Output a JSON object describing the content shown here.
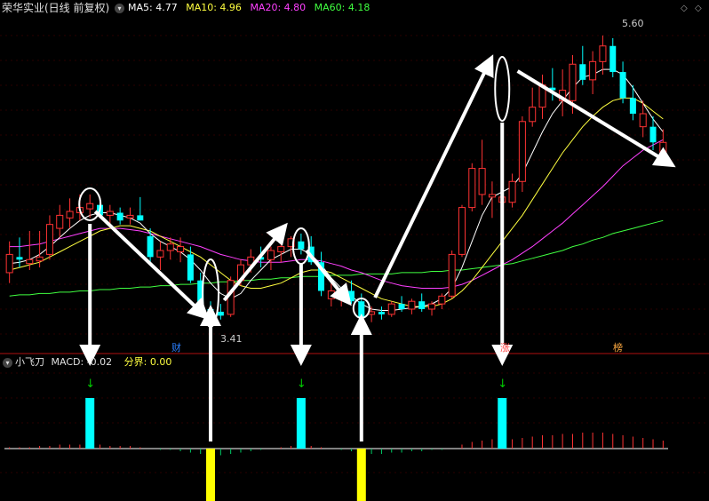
{
  "main_panel": {
    "stock_title": "荣华实业(日线 前复权)",
    "ma_labels": [
      {
        "text": "MA5: 4.77",
        "color": "#ffffff"
      },
      {
        "text": "MA10: 4.96",
        "color": "#ffff40"
      },
      {
        "text": "MA20: 4.80",
        "color": "#ff40ff"
      },
      {
        "text": "MA60: 4.18",
        "color": "#40ff40"
      }
    ],
    "high_marker": "5.60",
    "low_marker": "3.41",
    "badges": [
      {
        "text": "财",
        "color": "#2a7fff"
      },
      {
        "text": "涨",
        "color": "#ff4040"
      },
      {
        "text": "榜",
        "color": "#ffaa40"
      }
    ]
  },
  "sub_panel": {
    "indicator_name": "小飞刀",
    "macd_label": "MACD: -0.02",
    "boundary_label": "分界: 0.00"
  },
  "colors": {
    "up": "#ff3333",
    "down": "#00ffff",
    "ma5": "#ffffff",
    "ma10": "#ffff40",
    "ma20": "#ff40ff",
    "ma60": "#40ff40",
    "signal_bar": "#00ffff",
    "low_signal_bar": "#ffff00",
    "signal_arrow": "#00cc00",
    "divider": "#b01010"
  },
  "chart_data": {
    "type": "candlestick",
    "main_y_range": [
      3.2,
      5.75
    ],
    "candles": [
      {
        "o": 3.78,
        "h": 4.02,
        "l": 3.7,
        "c": 3.92,
        "up": true
      },
      {
        "o": 3.9,
        "h": 4.05,
        "l": 3.82,
        "c": 3.88,
        "up": false
      },
      {
        "o": 3.85,
        "h": 4.1,
        "l": 3.8,
        "c": 3.88,
        "up": true
      },
      {
        "o": 3.87,
        "h": 4.1,
        "l": 3.82,
        "c": 3.9,
        "up": true
      },
      {
        "o": 3.92,
        "h": 4.22,
        "l": 3.88,
        "c": 4.15,
        "up": true
      },
      {
        "o": 4.12,
        "h": 4.3,
        "l": 4.05,
        "c": 4.22,
        "up": true
      },
      {
        "o": 4.2,
        "h": 4.35,
        "l": 4.12,
        "c": 4.25,
        "up": true
      },
      {
        "o": 4.24,
        "h": 4.38,
        "l": 4.18,
        "c": 4.28,
        "up": true
      },
      {
        "o": 4.27,
        "h": 4.38,
        "l": 4.2,
        "c": 4.31,
        "up": true
      },
      {
        "o": 4.3,
        "h": 4.35,
        "l": 4.2,
        "c": 4.22,
        "up": false
      },
      {
        "o": 4.22,
        "h": 4.3,
        "l": 4.12,
        "c": 4.25,
        "up": true
      },
      {
        "o": 4.24,
        "h": 4.28,
        "l": 4.15,
        "c": 4.18,
        "up": false
      },
      {
        "o": 4.2,
        "h": 4.28,
        "l": 4.15,
        "c": 4.22,
        "up": true
      },
      {
        "o": 4.22,
        "h": 4.36,
        "l": 4.18,
        "c": 4.18,
        "up": false
      },
      {
        "o": 4.06,
        "h": 4.12,
        "l": 3.85,
        "c": 3.9,
        "up": false
      },
      {
        "o": 3.9,
        "h": 4.02,
        "l": 3.8,
        "c": 3.95,
        "up": true
      },
      {
        "o": 3.95,
        "h": 4.05,
        "l": 3.88,
        "c": 4.0,
        "up": true
      },
      {
        "o": 3.98,
        "h": 4.05,
        "l": 3.86,
        "c": 3.94,
        "up": true
      },
      {
        "o": 3.92,
        "h": 3.98,
        "l": 3.7,
        "c": 3.72,
        "up": false
      },
      {
        "o": 3.72,
        "h": 3.78,
        "l": 3.45,
        "c": 3.5,
        "up": false
      },
      {
        "o": 3.5,
        "h": 3.56,
        "l": 3.41,
        "c": 3.48,
        "up": false
      },
      {
        "o": 3.48,
        "h": 3.54,
        "l": 3.42,
        "c": 3.45,
        "up": false
      },
      {
        "o": 3.46,
        "h": 3.75,
        "l": 3.44,
        "c": 3.72,
        "up": true
      },
      {
        "o": 3.72,
        "h": 3.88,
        "l": 3.68,
        "c": 3.84,
        "up": true
      },
      {
        "o": 3.84,
        "h": 3.96,
        "l": 3.78,
        "c": 3.9,
        "up": true
      },
      {
        "o": 3.9,
        "h": 3.98,
        "l": 3.82,
        "c": 3.88,
        "up": false
      },
      {
        "o": 3.88,
        "h": 3.98,
        "l": 3.8,
        "c": 3.95,
        "up": true
      },
      {
        "o": 3.94,
        "h": 4.0,
        "l": 3.86,
        "c": 3.98,
        "up": true
      },
      {
        "o": 3.98,
        "h": 4.06,
        "l": 3.9,
        "c": 4.04,
        "up": true
      },
      {
        "o": 4.02,
        "h": 4.08,
        "l": 3.92,
        "c": 3.96,
        "up": false
      },
      {
        "o": 3.98,
        "h": 4.06,
        "l": 3.84,
        "c": 3.86,
        "up": false
      },
      {
        "o": 3.86,
        "h": 3.94,
        "l": 3.6,
        "c": 3.64,
        "up": false
      },
      {
        "o": 3.64,
        "h": 3.7,
        "l": 3.52,
        "c": 3.58,
        "up": true
      },
      {
        "o": 3.58,
        "h": 3.66,
        "l": 3.52,
        "c": 3.62,
        "up": true
      },
      {
        "o": 3.64,
        "h": 3.72,
        "l": 3.54,
        "c": 3.56,
        "up": false
      },
      {
        "o": 3.56,
        "h": 3.62,
        "l": 3.42,
        "c": 3.44,
        "up": false
      },
      {
        "o": 3.46,
        "h": 3.52,
        "l": 3.4,
        "c": 3.48,
        "up": true
      },
      {
        "o": 3.48,
        "h": 3.52,
        "l": 3.42,
        "c": 3.46,
        "up": false
      },
      {
        "o": 3.46,
        "h": 3.56,
        "l": 3.44,
        "c": 3.54,
        "up": true
      },
      {
        "o": 3.54,
        "h": 3.6,
        "l": 3.48,
        "c": 3.5,
        "up": false
      },
      {
        "o": 3.5,
        "h": 3.58,
        "l": 3.46,
        "c": 3.56,
        "up": true
      },
      {
        "o": 3.56,
        "h": 3.62,
        "l": 3.48,
        "c": 3.5,
        "up": false
      },
      {
        "o": 3.5,
        "h": 3.56,
        "l": 3.45,
        "c": 3.54,
        "up": true
      },
      {
        "o": 3.54,
        "h": 3.62,
        "l": 3.5,
        "c": 3.6,
        "up": true
      },
      {
        "o": 3.6,
        "h": 3.95,
        "l": 3.58,
        "c": 3.92,
        "up": true
      },
      {
        "o": 3.92,
        "h": 4.3,
        "l": 3.9,
        "c": 4.28,
        "up": true
      },
      {
        "o": 4.28,
        "h": 4.62,
        "l": 4.25,
        "c": 4.58,
        "up": true
      },
      {
        "o": 4.58,
        "h": 4.8,
        "l": 4.3,
        "c": 4.38,
        "up": true
      },
      {
        "o": 4.38,
        "h": 4.48,
        "l": 4.2,
        "c": 4.36,
        "up": true
      },
      {
        "o": 4.36,
        "h": 4.5,
        "l": 4.24,
        "c": 4.32,
        "up": true
      },
      {
        "o": 4.32,
        "h": 4.54,
        "l": 4.28,
        "c": 4.48,
        "up": true
      },
      {
        "o": 4.48,
        "h": 4.98,
        "l": 4.4,
        "c": 4.94,
        "up": true
      },
      {
        "o": 4.94,
        "h": 5.2,
        "l": 4.9,
        "c": 5.05,
        "up": true
      },
      {
        "o": 5.05,
        "h": 5.3,
        "l": 4.96,
        "c": 5.22,
        "up": true
      },
      {
        "o": 5.2,
        "h": 5.35,
        "l": 5.1,
        "c": 5.18,
        "up": false
      },
      {
        "o": 5.18,
        "h": 5.34,
        "l": 4.98,
        "c": 5.1,
        "up": true
      },
      {
        "o": 5.1,
        "h": 5.45,
        "l": 5.0,
        "c": 5.38,
        "up": true
      },
      {
        "o": 5.38,
        "h": 5.52,
        "l": 5.22,
        "c": 5.26,
        "up": false
      },
      {
        "o": 5.26,
        "h": 5.48,
        "l": 5.15,
        "c": 5.4,
        "up": true
      },
      {
        "o": 5.4,
        "h": 5.6,
        "l": 5.3,
        "c": 5.52,
        "up": true
      },
      {
        "o": 5.52,
        "h": 5.58,
        "l": 5.28,
        "c": 5.32,
        "up": false
      },
      {
        "o": 5.32,
        "h": 5.4,
        "l": 5.08,
        "c": 5.12,
        "up": false
      },
      {
        "o": 5.12,
        "h": 5.22,
        "l": 4.95,
        "c": 5.0,
        "up": false
      },
      {
        "o": 5.0,
        "h": 5.1,
        "l": 4.82,
        "c": 4.9,
        "up": true
      },
      {
        "o": 4.9,
        "h": 4.98,
        "l": 4.72,
        "c": 4.78,
        "up": false
      },
      {
        "o": 4.78,
        "h": 4.88,
        "l": 4.62,
        "c": 4.7,
        "up": true
      }
    ],
    "ma5": [
      3.85,
      3.86,
      3.88,
      3.92,
      3.98,
      4.05,
      4.12,
      4.18,
      4.22,
      4.24,
      4.24,
      4.22,
      4.2,
      4.16,
      4.08,
      4.02,
      3.98,
      3.94,
      3.88,
      3.8,
      3.7,
      3.62,
      3.58,
      3.62,
      3.72,
      3.8,
      3.88,
      3.92,
      3.96,
      3.96,
      3.92,
      3.84,
      3.74,
      3.66,
      3.6,
      3.54,
      3.5,
      3.49,
      3.49,
      3.5,
      3.51,
      3.52,
      3.54,
      3.58,
      3.66,
      3.82,
      4.02,
      4.22,
      4.36,
      4.4,
      4.44,
      4.54,
      4.7,
      4.86,
      5.0,
      5.1,
      5.2,
      5.28,
      5.3,
      5.34,
      5.34,
      5.3,
      5.2,
      5.08,
      4.96,
      4.86
    ],
    "ma10": [
      3.8,
      3.82,
      3.84,
      3.86,
      3.9,
      3.94,
      3.98,
      4.02,
      4.06,
      4.1,
      4.12,
      4.14,
      4.14,
      4.12,
      4.1,
      4.06,
      4.02,
      3.98,
      3.94,
      3.9,
      3.84,
      3.78,
      3.72,
      3.68,
      3.66,
      3.66,
      3.68,
      3.7,
      3.74,
      3.78,
      3.8,
      3.8,
      3.78,
      3.74,
      3.7,
      3.66,
      3.62,
      3.58,
      3.56,
      3.54,
      3.52,
      3.52,
      3.52,
      3.54,
      3.58,
      3.64,
      3.72,
      3.82,
      3.92,
      4.02,
      4.12,
      4.22,
      4.34,
      4.46,
      4.58,
      4.7,
      4.8,
      4.9,
      4.98,
      5.05,
      5.1,
      5.12,
      5.12,
      5.08,
      5.02,
      4.96
    ],
    "ma20": [
      3.98,
      3.98,
      3.99,
      4.0,
      4.02,
      4.04,
      4.06,
      4.08,
      4.1,
      4.12,
      4.12,
      4.12,
      4.11,
      4.1,
      4.08,
      4.06,
      4.04,
      4.02,
      4.0,
      3.98,
      3.95,
      3.92,
      3.9,
      3.88,
      3.87,
      3.86,
      3.86,
      3.86,
      3.87,
      3.88,
      3.88,
      3.87,
      3.85,
      3.83,
      3.8,
      3.78,
      3.75,
      3.72,
      3.7,
      3.68,
      3.67,
      3.66,
      3.66,
      3.66,
      3.67,
      3.69,
      3.72,
      3.76,
      3.8,
      3.84,
      3.88,
      3.93,
      3.98,
      4.04,
      4.1,
      4.16,
      4.23,
      4.3,
      4.37,
      4.44,
      4.52,
      4.6,
      4.66,
      4.72,
      4.76,
      4.8
    ],
    "ma60": [
      3.6,
      3.61,
      3.61,
      3.62,
      3.62,
      3.63,
      3.63,
      3.64,
      3.64,
      3.65,
      3.65,
      3.66,
      3.66,
      3.67,
      3.67,
      3.68,
      3.68,
      3.69,
      3.69,
      3.7,
      3.7,
      3.71,
      3.71,
      3.72,
      3.72,
      3.73,
      3.73,
      3.74,
      3.74,
      3.75,
      3.75,
      3.75,
      3.76,
      3.76,
      3.76,
      3.77,
      3.77,
      3.77,
      3.77,
      3.78,
      3.78,
      3.78,
      3.79,
      3.79,
      3.8,
      3.8,
      3.81,
      3.82,
      3.83,
      3.84,
      3.85,
      3.87,
      3.89,
      3.91,
      3.93,
      3.95,
      3.98,
      4.0,
      4.03,
      4.05,
      4.08,
      4.1,
      4.12,
      4.14,
      4.16,
      4.18
    ],
    "macd_hist": [
      0.01,
      0.01,
      0.01,
      0.02,
      0.02,
      0.03,
      0.03,
      0.03,
      0.03,
      0.03,
      0.02,
      0.02,
      0.02,
      0.01,
      0.0,
      -0.01,
      -0.01,
      -0.02,
      -0.03,
      -0.04,
      -0.05,
      -0.05,
      -0.04,
      -0.03,
      -0.02,
      -0.01,
      0.0,
      0.01,
      0.02,
      0.02,
      0.02,
      0.01,
      0.0,
      -0.01,
      -0.02,
      -0.03,
      -0.04,
      -0.04,
      -0.03,
      -0.03,
      -0.02,
      -0.02,
      -0.01,
      -0.01,
      0.0,
      0.03,
      0.05,
      0.06,
      0.07,
      0.07,
      0.07,
      0.08,
      0.09,
      0.1,
      0.1,
      0.11,
      0.11,
      0.12,
      0.12,
      0.12,
      0.11,
      0.1,
      0.09,
      0.08,
      0.07,
      0.06
    ],
    "signal_bars": [
      {
        "index": 8,
        "value": 1.0,
        "type": "top"
      },
      {
        "index": 20,
        "value": -1.0,
        "type": "bottom"
      },
      {
        "index": 29,
        "value": 1.0,
        "type": "top"
      },
      {
        "index": 35,
        "value": -1.0,
        "type": "bottom"
      },
      {
        "index": 49,
        "value": 1.0,
        "type": "top"
      }
    ]
  }
}
